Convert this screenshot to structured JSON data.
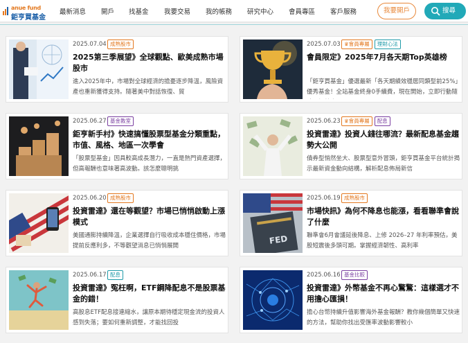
{
  "header": {
    "logo_en": "anue fund",
    "logo_zh": "鉅亨買基金",
    "nav": [
      "最新消息",
      "開戶",
      "找基金",
      "我要交易",
      "我的帳務",
      "研究中心",
      "會員專區",
      "客戶服務"
    ],
    "open_account": "我要開戶",
    "search": "搜尋"
  },
  "articles": [
    {
      "date": "2025.07.04",
      "tags": [
        {
          "label": "成熟股市",
          "color": "orange"
        }
      ],
      "title": "2025第三季展望》全球觀點、歐美成熟市場股市",
      "excerpt": "進入2025年中，市場對全球經濟的擔憂逐步降溫，風險資產也重新獲得支持。隨著美中對話恢復、貿"
    },
    {
      "date": "2025.07.03",
      "tags": [
        {
          "label": "會員專屬",
          "color": "orange",
          "icon": "crown-icon"
        },
        {
          "label": "理財心法",
          "color": "teal"
        }
      ],
      "title": "會員限定》2025年7月各天期Top英雄榜",
      "excerpt": "「鉅亨買基金」優選最新「各天期績效穩居同類型前25%」優秀基金！全站基金終身0手續費，現在開始，立即行動隨時買好基金！"
    },
    {
      "date": "2025.06.27",
      "tags": [
        {
          "label": "基金教室",
          "color": "purple"
        }
      ],
      "title": "鉅亨新手村》快速搞懂股票型基金分類重點，市值、風格、地區一次學會",
      "excerpt": "「股票型基金」因具較高成長潛力，一直是熱門資產選擇，但高報酬也意味著高波動。該怎麼聰明挑"
    },
    {
      "date": "2025.06.23",
      "tags": [
        {
          "label": "會員專屬",
          "color": "orange",
          "icon": "crown-icon"
        },
        {
          "label": "配息",
          "color": "purple"
        }
      ],
      "title": "投資雷達》投資人錢往哪流？最新配息基金趨勢大公開",
      "excerpt": "債券型悄然坐大、股票型意外冒頭，鉅亨買基金平台統計揭示最新資金動向結構，解析配息佈局新信"
    },
    {
      "date": "2025.06.20",
      "tags": [
        {
          "label": "成熟股市",
          "color": "orange"
        }
      ],
      "title": "投資雷達》還在等觀望？市場已悄悄啟動上漲模式",
      "excerpt": "美國通膨持續降溫，企業選擇自行吸收成本穩住價格，市場提前反應利多，不等觀望消息已悄悄展開"
    },
    {
      "date": "2025.06.19",
      "tags": [
        {
          "label": "成熟股市",
          "color": "orange"
        }
      ],
      "title": "市場快訊》為何不降息也能漲，看看聯準會說了什麼",
      "excerpt": "聯準會6月會議延後降息、上修 2026–27 年利率預估，美股短震後多頭可期。掌握經濟韌性、高利率"
    },
    {
      "date": "2025.06.17",
      "tags": [
        {
          "label": "配息",
          "color": "teal"
        }
      ],
      "title": "投資雷達》冤枉啊，ETF鋼降配息不是股票基金的錯！",
      "excerpt": "高股息ETF配息接連縮水，讓原本期待穩定現金流的投資人感到失落；要如何重新調整，才能找回投"
    },
    {
      "date": "2025.06.16",
      "tags": [
        {
          "label": "基金比較",
          "color": "purple"
        }
      ],
      "title": "投資雷達》外幣基金不再心驚驚：這樣選才不用擔心匯損！",
      "excerpt": "擔心台幣持續升值影響海外基金報酬？教你幾個簡單又快速的方法，幫助你找出受匯率波動影響較小"
    }
  ]
}
